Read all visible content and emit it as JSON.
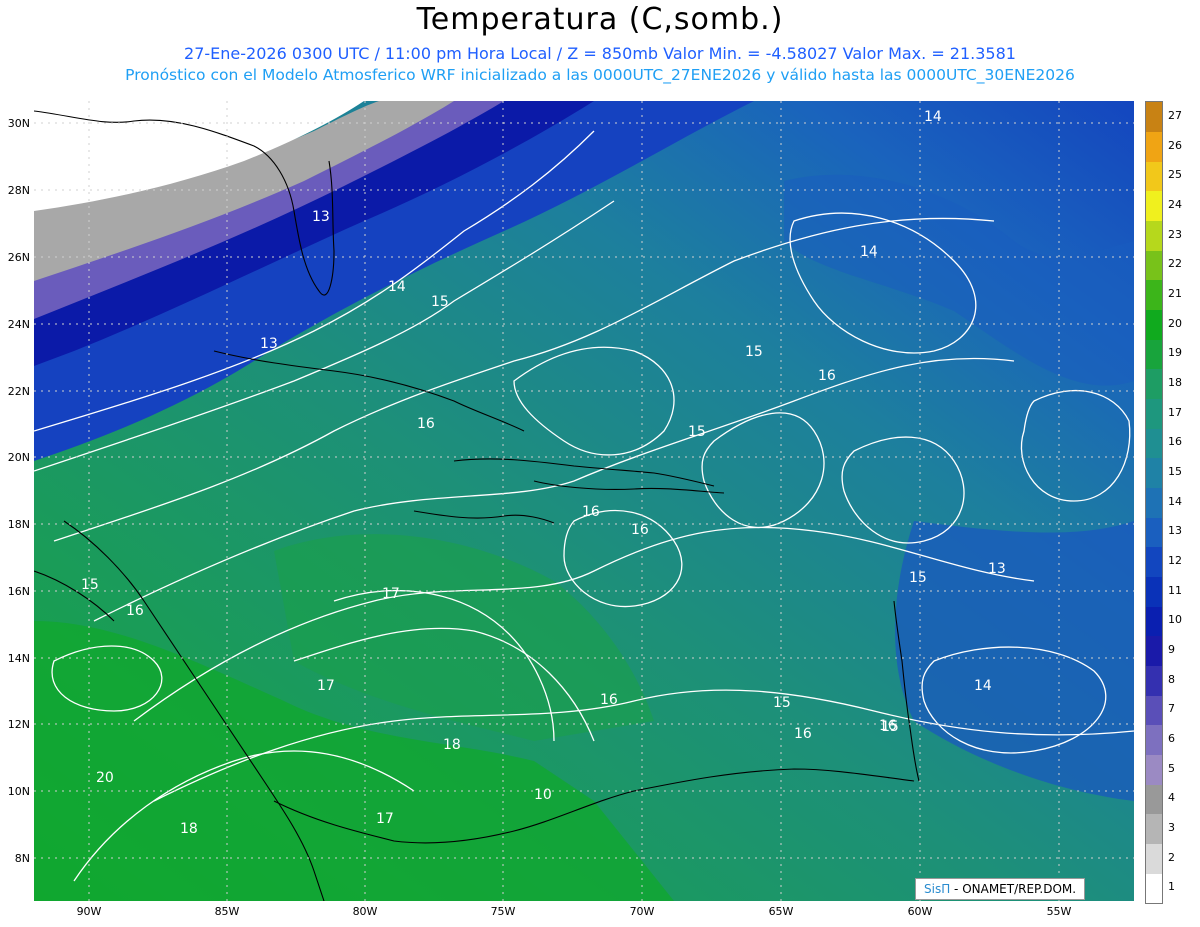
{
  "title": "Temperatura (C,somb.)",
  "subtitle_line1": "27-Ene-2026  0300 UTC / 11:00 pm Hora Local / Z = 850mb  Valor Min. = -4.58027  Valor Max. = 21.3581",
  "subtitle_line2": "Pronóstico con el Modelo Atmosferico WRF inicializado a las 0000UTC_27ENE2026 y válido hasta las  0000UTC_30ENE2026",
  "lat_labels": [
    "30N",
    "28N",
    "26N",
    "24N",
    "22N",
    "20N",
    "18N",
    "16N",
    "14N",
    "12N",
    "10N",
    "8N"
  ],
  "lon_labels": [
    "90W",
    "85W",
    "80W",
    "75W",
    "70W",
    "65W",
    "60W",
    "55W"
  ],
  "colorbar": {
    "labels": [
      "1",
      "2",
      "3",
      "4",
      "5",
      "6",
      "7",
      "8",
      "9",
      "10",
      "11",
      "12",
      "13",
      "14",
      "15",
      "16",
      "17",
      "18",
      "19",
      "20",
      "21",
      "22",
      "23",
      "24",
      "25",
      "26",
      "27"
    ],
    "colors": [
      "#ffffff",
      "#dadada",
      "#b5b5b5",
      "#999999",
      "#9b8ac3",
      "#7d70bf",
      "#5a4fb8",
      "#3430b0",
      "#1a1aa9",
      "#0a1fb0",
      "#0a32b8",
      "#1246bf",
      "#1a5fbf",
      "#1e72b5",
      "#1f82a6",
      "#1f8f92",
      "#1e977e",
      "#1e9d64",
      "#18a43c",
      "#10aa1e",
      "#3cb51a",
      "#78c21a",
      "#b6d81c",
      "#f0f01e",
      "#f2c81a",
      "#f0a414",
      "#c88214"
    ]
  },
  "contour_labels": [
    {
      "text": "13"
    },
    {
      "text": "13"
    },
    {
      "text": "14"
    },
    {
      "text": "15"
    },
    {
      "text": "16"
    },
    {
      "text": "14"
    },
    {
      "text": "14"
    },
    {
      "text": "15"
    },
    {
      "text": "16"
    },
    {
      "text": "15"
    },
    {
      "text": "16"
    },
    {
      "text": "16"
    },
    {
      "text": "16"
    },
    {
      "text": "15"
    },
    {
      "text": "13"
    },
    {
      "text": "15"
    },
    {
      "text": "16"
    },
    {
      "text": "17"
    },
    {
      "text": "17"
    },
    {
      "text": "16"
    },
    {
      "text": "15"
    },
    {
      "text": "14"
    },
    {
      "text": "16"
    },
    {
      "text": "15"
    },
    {
      "text": "18"
    },
    {
      "text": "20"
    },
    {
      "text": "18"
    },
    {
      "text": "17"
    },
    {
      "text": "10"
    }
  ],
  "credit": {
    "brand": "SisΠ",
    "org": " - ONAMET/REP.DOM."
  }
}
